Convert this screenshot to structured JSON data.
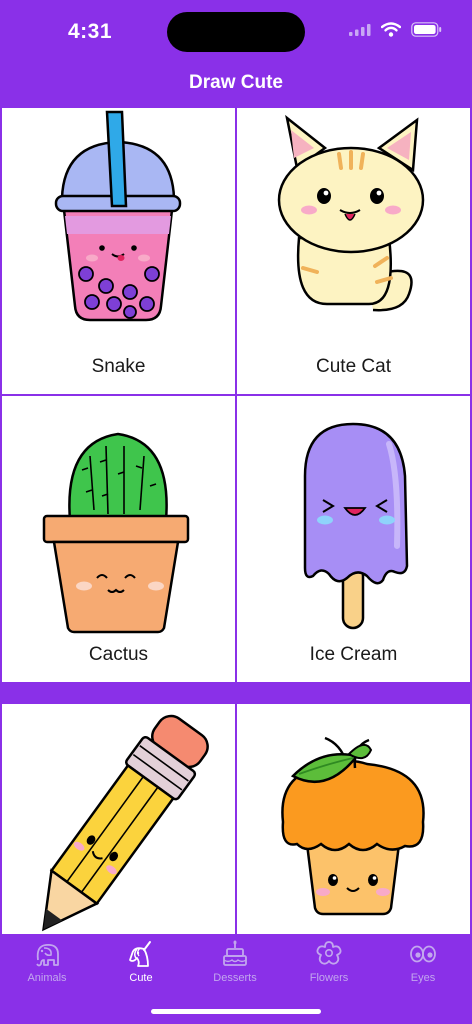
{
  "status": {
    "time": "4:31"
  },
  "nav": {
    "title": "Draw Cute"
  },
  "items": [
    {
      "label": "Snake",
      "image": "bubble-tea-drawing"
    },
    {
      "label": "Cute Cat",
      "image": "cat-drawing"
    },
    {
      "label": "Cactus",
      "image": "cactus-drawing"
    },
    {
      "label": "Ice Cream",
      "image": "popsicle-drawing"
    },
    {
      "label": "",
      "image": "pencil-drawing"
    },
    {
      "label": "",
      "image": "cupcake-drawing"
    }
  ],
  "tabs": [
    {
      "label": "Animals",
      "icon": "elephant-icon",
      "active": false
    },
    {
      "label": "Cute",
      "icon": "unicorn-icon",
      "active": true
    },
    {
      "label": "Desserts",
      "icon": "cake-icon",
      "active": false
    },
    {
      "label": "Flowers",
      "icon": "flower-icon",
      "active": false
    },
    {
      "label": "Eyes",
      "icon": "eyes-icon",
      "active": false
    }
  ],
  "colors": {
    "accent": "#8a30e8",
    "tab_inactive": "#c2a6ee",
    "tab_active": "#ffffff"
  }
}
